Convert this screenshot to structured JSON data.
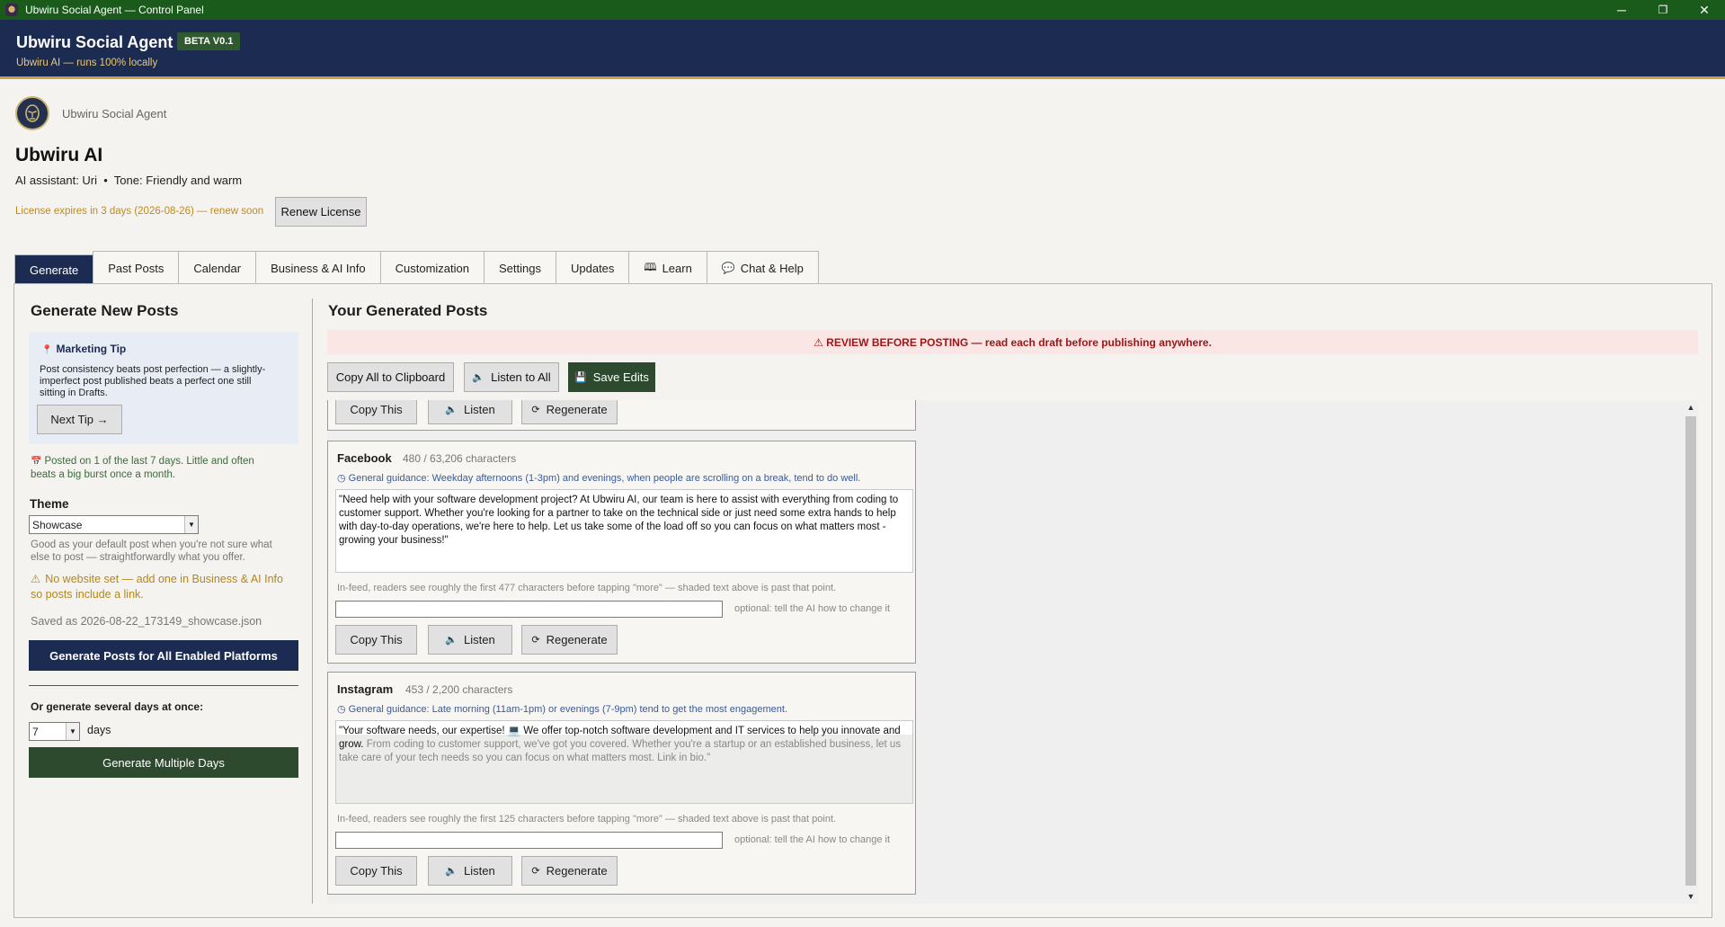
{
  "window": {
    "title": "Ubwiru Social Agent — Control Panel",
    "min": "─",
    "max": "❐",
    "close": "✕"
  },
  "header": {
    "app_title": "Ubwiru Social Agent",
    "badge": "BETA V0.1",
    "subtitle": "Ubwiru AI — runs 100% locally"
  },
  "profile": {
    "brand_small": "Ubwiru Social Agent",
    "business_name": "Ubwiru AI",
    "assistant_line": "AI assistant: Uri  •  Tone: Friendly and warm",
    "license_text": "License expires in 3 days (2026-08-26) — renew soon",
    "renew_label": "Renew License"
  },
  "tabs": [
    {
      "label": "Generate",
      "icon": ""
    },
    {
      "label": "Past Posts",
      "icon": ""
    },
    {
      "label": "Calendar",
      "icon": ""
    },
    {
      "label": "Business & AI Info",
      "icon": ""
    },
    {
      "label": "Customization",
      "icon": ""
    },
    {
      "label": "Settings",
      "icon": ""
    },
    {
      "label": "Updates",
      "icon": ""
    },
    {
      "label": "Learn",
      "icon": "🕮"
    },
    {
      "label": "Chat & Help",
      "icon": "💬"
    }
  ],
  "left": {
    "heading": "Generate New Posts",
    "tip_title": "Marketing Tip",
    "tip_text": "Post consistency beats post perfection — a slightly-imperfect post published beats a perfect one still sitting in Drafts.",
    "next_tip": "Next Tip →",
    "posted_text": "Posted on 1 of the last 7 days. Little and often beats a big burst once a month.",
    "theme_label": "Theme",
    "theme_value": "Showcase",
    "theme_help": "Good as your default post when you're not sure what else to post — straightforwardly what you offer.",
    "no_website": "No website set — add one in Business & AI Info so posts include a link.",
    "saved_as": "Saved as 2026-08-22_173149_showcase.json",
    "generate_all": "Generate Posts for All Enabled Platforms",
    "multi_label": "Or generate several days at once:",
    "days_value": "7",
    "days_label": "days",
    "generate_multi": "Generate Multiple Days"
  },
  "right": {
    "heading": "Your Generated Posts",
    "review_banner": "⚠ REVIEW BEFORE POSTING — read each draft before publishing anywhere.",
    "copy_all": "Copy All to Clipboard",
    "listen_all": "Listen to All",
    "save_edits": "Save Edits",
    "copy_this": "Copy This",
    "listen": "Listen",
    "regenerate": "Regenerate",
    "optional_hint": "optional: tell the AI how to change it",
    "posts": [
      {
        "platform": "Facebook",
        "count": "480 / 63,206 characters",
        "guidance": "◷ General guidance: Weekday afternoons (1-3pm) and evenings, when people are scrolling on a break, tend to do well.",
        "text": "\"Need help with your software development project? At Ubwiru AI, our team is here to assist with everything from coding to customer support. Whether you're looking for a partner to take on the technical side or just need some extra hands to help with day-to-day operations, we're here to help. Let us take some of the load off so you can focus on what matters most - growing your business!\"",
        "shaded_text": "",
        "feed_note": "In-feed, readers see roughly the first 477 characters before tapping \"more\" — shaded text above is past that point."
      },
      {
        "platform": "Instagram",
        "count": "453 / 2,200 characters",
        "guidance": "◷ General guidance: Late morning (11am-1pm) or evenings (7-9pm) tend to get the most engagement.",
        "text": "\"Your software needs, our expertise! 💻 We offer top-notch software development and IT services to help you innovate and grow. ",
        "shaded_text": "From coding to customer support, we've got you covered. Whether you're a startup or an established business, let us take care of your tech needs so you can focus on what matters most. Link in bio.\"",
        "feed_note": "In-feed, readers see roughly the first 125 characters before tapping \"more\" — shaded text above is past that point."
      }
    ]
  },
  "colors": {
    "titlebar": "#1a5a1a",
    "header": "#1b2b52",
    "accent_gold": "#c9a24a",
    "dark_green_button": "#2d4a2f",
    "review_red": "#a31515"
  }
}
